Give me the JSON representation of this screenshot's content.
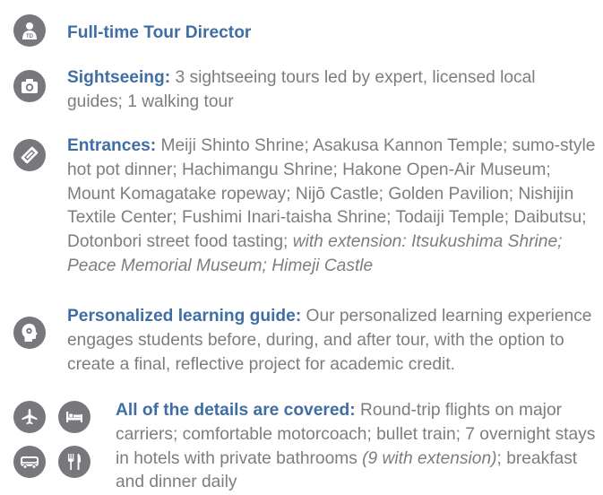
{
  "features": [
    {
      "icon": "tour-director-icon",
      "label": "Full-time Tour Director",
      "text": ""
    },
    {
      "icon": "camera-icon",
      "label": "Sightseeing:",
      "text": " 3 sightseeing tours led by expert, licensed local guides; 1 walking tour"
    },
    {
      "icon": "ticket-icon",
      "label": "Entrances:",
      "text": " Meiji Shinto Shrine; Asakusa Kannon Temple; sumo-style hot pot dinner; Hachimangu Shrine; Hakone Open-Air Museum; Mount Komagatake ropeway; Nijō Castle; Golden Pavilion; Nishijin Textile Center; Fushimi Inari-taisha Shrine; Todaiji Temple; Daibutsu; Dotonbori street food tasting; ",
      "italic": "with extension: Itsukushima Shrine; Peace Memorial Museum; Himeji Castle"
    },
    {
      "icon": "head-brain-icon",
      "label": "Personalized learning guide:",
      "text": " Our personalized learning experience engages students before, during, and after tour, with the option to create a final, reflective project for academic credit."
    },
    {
      "icons": [
        "airplane-icon",
        "bed-icon",
        "bus-icon",
        "fork-knife-icon"
      ],
      "label": "All of the details are covered:",
      "text": " Round-trip flights on major carriers; comfortable motorcoach; bullet train; 7 overnight stays in hotels with private bathrooms ",
      "italic": "(9 with extension)",
      "text_after": "; breakfast and dinner daily"
    }
  ]
}
